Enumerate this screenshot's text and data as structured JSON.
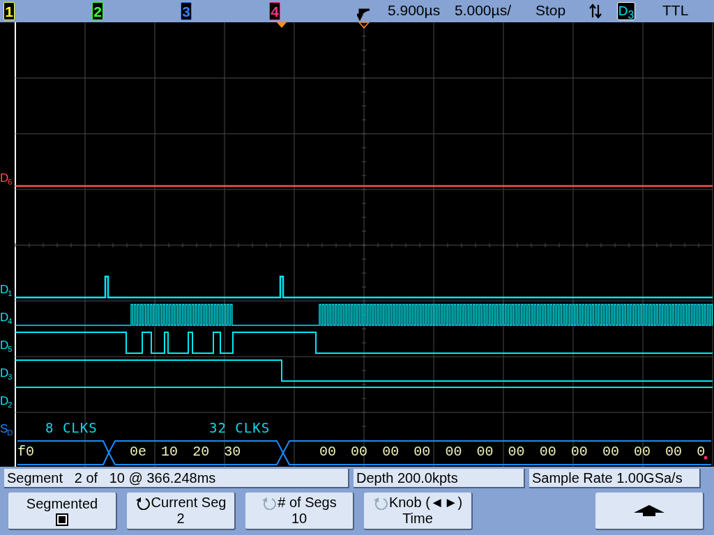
{
  "top_bar": {
    "channels": [
      {
        "label": "1",
        "color": "#ffff30"
      },
      {
        "label": "2",
        "color": "#40ff40"
      },
      {
        "label": "3",
        "color": "#3a7cff"
      },
      {
        "label": "4",
        "color": "#ff3080"
      }
    ],
    "trigger_delay": "5.900µs",
    "time_per_div": "5.000µs/",
    "run_state": "Stop",
    "trigger_source": "D$_{3}$",
    "trigger_level": "TTL"
  },
  "display": {
    "digital_channels": [
      {
        "label": "D$_{6}$",
        "color": "#ff5050"
      },
      {
        "label": "D$_{1}$",
        "color": "#00e8f0"
      },
      {
        "label": "D$_{4}$",
        "color": "#00e8f0"
      },
      {
        "label": "D$_{5}$",
        "color": "#00e8f0"
      },
      {
        "label": "D$_{3}$",
        "color": "#00e8f0"
      },
      {
        "label": "D$_{2}$",
        "color": "#00e8f0"
      }
    ],
    "bus": {
      "label": "S$_{D}$",
      "color": "#1a8cff",
      "annotations": [
        "8 CLKS",
        "32 CLKS"
      ],
      "packets": [
        {
          "bytes": [
            "f0"
          ]
        },
        {
          "bytes": [
            "0e",
            "10",
            "20",
            "30"
          ]
        },
        {
          "bytes": [
            "00",
            "00",
            "00",
            "00",
            "00",
            "00",
            "00",
            "00",
            "00",
            "00",
            "00",
            "00",
            "0"
          ]
        }
      ]
    }
  },
  "status": {
    "segment": "Segment   2 of   10 @ 366.248ms",
    "depth": "Depth 200.0kpts",
    "sample_rate": "Sample Rate 1.00GSa/s"
  },
  "softkeys": [
    {
      "kind": "checkbox",
      "label": "Segmented",
      "checked": true
    },
    {
      "kind": "knob",
      "label": "Current Seg",
      "value": "2",
      "active": true
    },
    {
      "kind": "knob",
      "label": "# of Segs",
      "value": "10",
      "active": false
    },
    {
      "kind": "knob",
      "label": "Knob (◄►)",
      "value": "Time",
      "active": false
    },
    {
      "kind": "arrow"
    }
  ]
}
